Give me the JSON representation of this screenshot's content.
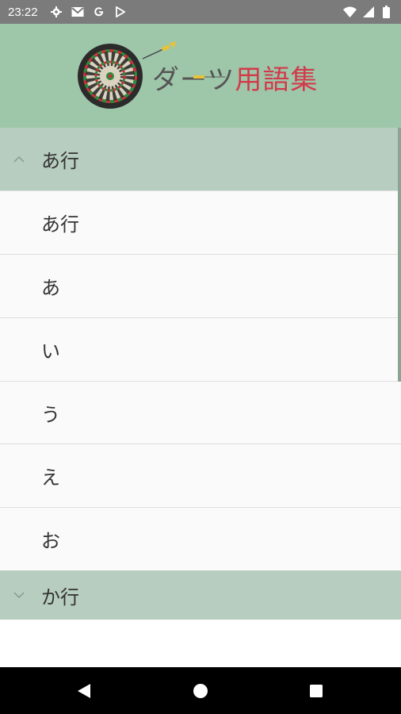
{
  "status_bar": {
    "time": "23:22",
    "left_icons": [
      "gear-icon",
      "gmail-icon",
      "google-icon",
      "play-store-icon"
    ],
    "right_icons": [
      "wifi-icon",
      "signal-icon",
      "battery-icon"
    ]
  },
  "header": {
    "title_part1": "ダーツ",
    "title_part2": "用語集"
  },
  "groups": [
    {
      "label": "あ行",
      "expanded": true,
      "items": [
        "あ行",
        "あ",
        "い",
        "う",
        "え",
        "お"
      ]
    },
    {
      "label": "か行",
      "expanded": false,
      "items": []
    }
  ],
  "nav_bar": {
    "buttons": [
      "back-icon",
      "home-icon",
      "recents-icon"
    ]
  },
  "colors": {
    "header_bg": "#9ec7aa",
    "group_bg": "#b7cdbf",
    "row_bg": "#fafafa",
    "title_accent": "#d23a4a"
  }
}
